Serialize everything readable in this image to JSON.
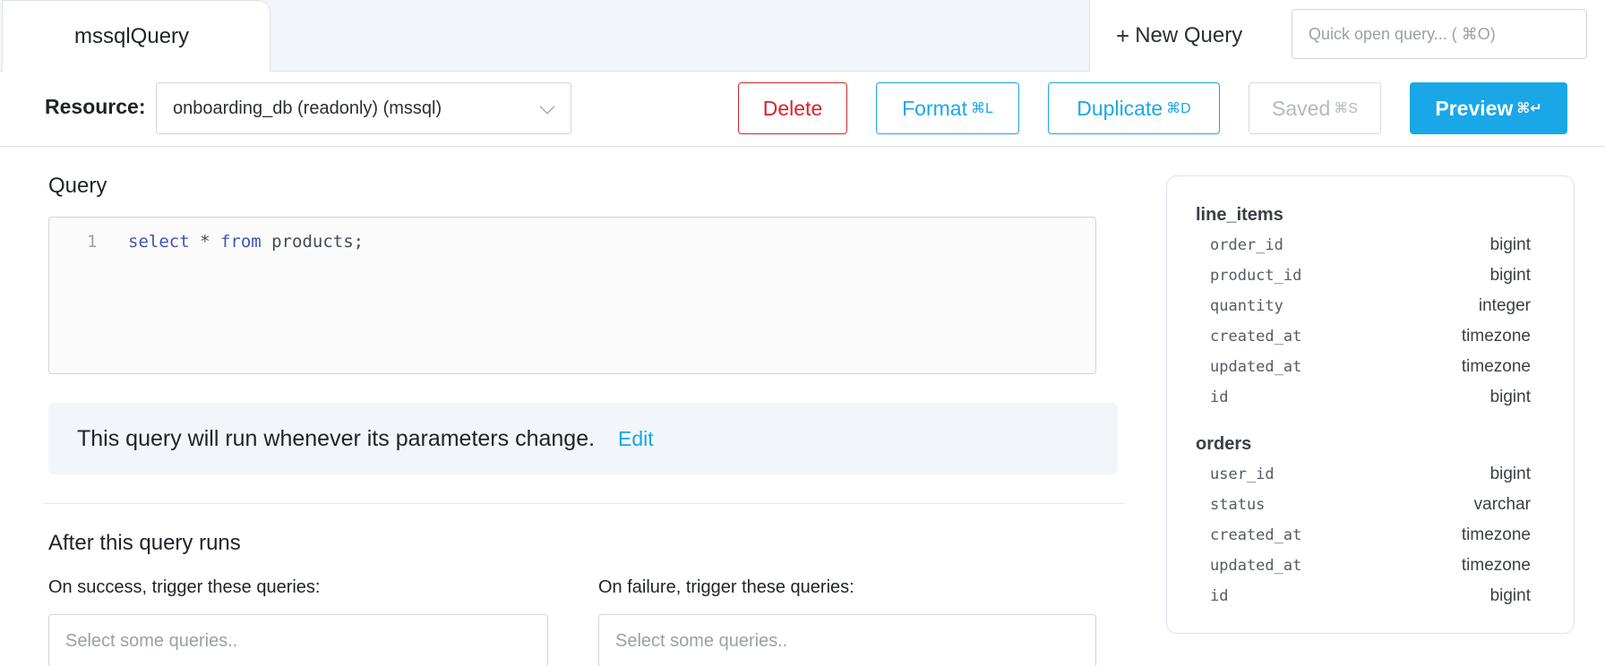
{
  "tabs": {
    "active_tab": "mssqlQuery",
    "new_query_label": "New Query",
    "quick_open_placeholder": "Quick open query... ( ⌘O)"
  },
  "toolbar": {
    "resource_label": "Resource:",
    "resource_value": "onboarding_db (readonly) (mssql)",
    "delete_label": "Delete",
    "format_label": "Format",
    "format_shortcut": "⌘L",
    "duplicate_label": "Duplicate",
    "duplicate_shortcut": "⌘D",
    "saved_label": "Saved",
    "saved_shortcut": "⌘S",
    "preview_label": "Preview",
    "preview_shortcut": "⌘↵"
  },
  "query": {
    "title": "Query",
    "line_number": "1",
    "code_kw1": "select",
    "code_mid": " * ",
    "code_kw2": "from",
    "code_rest": " products;"
  },
  "notice": {
    "text": "This query will run whenever its parameters change.",
    "edit_label": "Edit"
  },
  "after": {
    "title": "After this query runs",
    "success_label": "On success, trigger these queries:",
    "failure_label": "On failure, trigger these queries:",
    "success_placeholder": "Select some queries..",
    "failure_placeholder": "Select some queries.."
  },
  "schema": {
    "tables": [
      {
        "name": "line_items",
        "columns": [
          {
            "name": "order_id",
            "type": "bigint"
          },
          {
            "name": "product_id",
            "type": "bigint"
          },
          {
            "name": "quantity",
            "type": "integer"
          },
          {
            "name": "created_at",
            "type": "timezone"
          },
          {
            "name": "updated_at",
            "type": "timezone"
          },
          {
            "name": "id",
            "type": "bigint"
          }
        ]
      },
      {
        "name": "orders",
        "columns": [
          {
            "name": "user_id",
            "type": "bigint"
          },
          {
            "name": "status",
            "type": "varchar"
          },
          {
            "name": "created_at",
            "type": "timezone"
          },
          {
            "name": "updated_at",
            "type": "timezone"
          },
          {
            "name": "id",
            "type": "bigint"
          }
        ]
      }
    ]
  }
}
